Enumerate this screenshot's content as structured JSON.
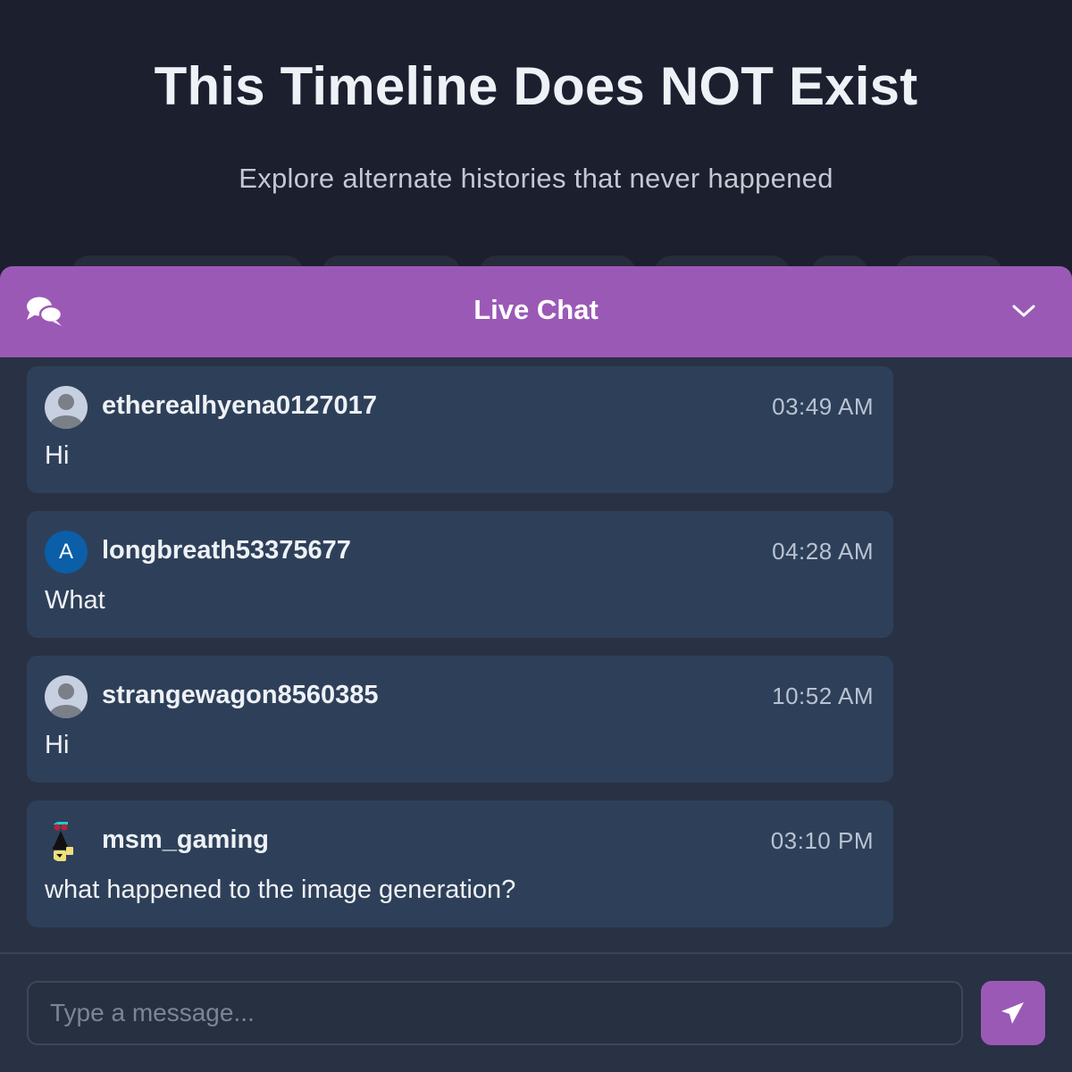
{
  "page": {
    "title": "This Timeline Does NOT Exist",
    "subtitle": "Explore alternate histories that never happened"
  },
  "chat": {
    "title": "Live Chat",
    "header_icon": "chat-bubbles-icon",
    "collapse_icon": "chevron-down-icon",
    "messages": [
      {
        "username": "etherealhyena0127017",
        "time": "03:49 AM",
        "text": "Hi",
        "avatar": "default-user-avatar"
      },
      {
        "username": "longbreath53375677",
        "time": "04:28 AM",
        "text": "What",
        "avatar_letter": "A"
      },
      {
        "username": "strangewagon8560385",
        "time": "10:52 AM",
        "text": "Hi",
        "avatar": "default-user-avatar"
      },
      {
        "username": "msm_gaming",
        "time": "03:10 PM",
        "text": "what happened to the image generation?",
        "avatar": "custom-character-avatar"
      }
    ],
    "input": {
      "placeholder": "Type a message...",
      "value": ""
    },
    "send_icon": "paper-plane-icon"
  },
  "colors": {
    "accent": "#9b59b6",
    "page_background": "#1b1f2e",
    "panel_background": "#283244",
    "message_background": "#2e4059",
    "letter_avatar": "#0b5ea8"
  }
}
